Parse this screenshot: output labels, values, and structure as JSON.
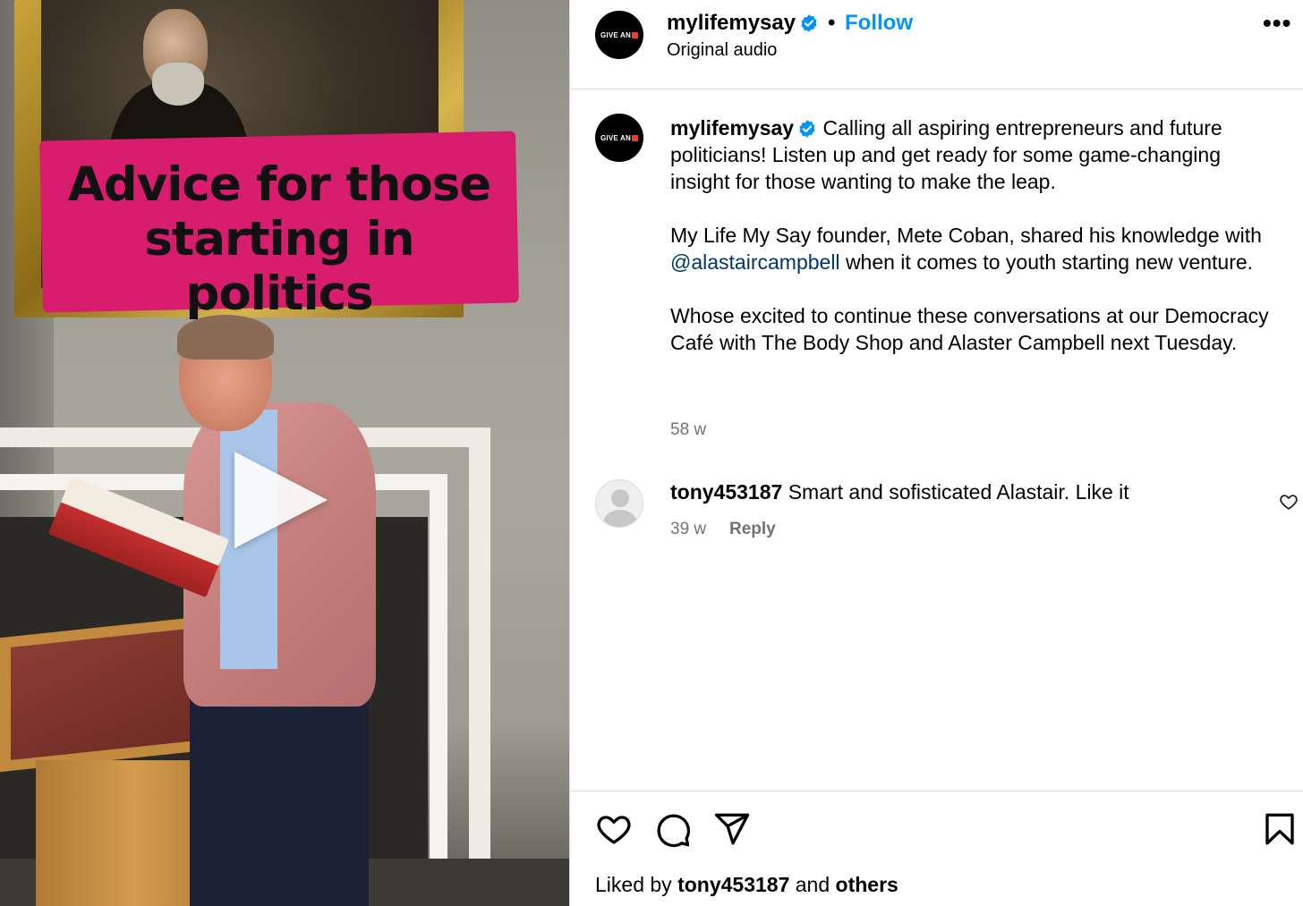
{
  "video": {
    "overlay_text_line1": "Advice for those",
    "overlay_text_line2": "starting in politics",
    "banner_color": "#d81c6e",
    "play_icon": "play-icon"
  },
  "header": {
    "avatar_text": "GIVE AN",
    "username": "mylifemysay",
    "separator": "•",
    "follow_label": "Follow",
    "audio": "Original audio",
    "more_label": "•••"
  },
  "caption": {
    "username": "mylifemysay",
    "para1": "Calling all aspiring entrepreneurs and future politicians! Listen up and get ready for some game-changing insight for those wanting to make the leap.",
    "para2_before": "My Life My Say founder, Mete Coban, shared his knowledge with",
    "mention": "@alastaircampbell",
    "para2_after": "when it comes to youth starting new venture.",
    "para3": "Whose excited to continue these conversations at our Democracy Café with The Body Shop and Alaster Campbell next Tuesday.",
    "time": "58 w"
  },
  "comment": {
    "username": "tony453187",
    "text": "Smart and sofisticated Alastair. Like it",
    "time": "39 w",
    "reply_label": "Reply"
  },
  "footer": {
    "liked_by_prefix": "Liked by",
    "liked_by_user": "tony453187",
    "liked_by_and": "and",
    "liked_by_others": "others"
  },
  "colors": {
    "accent": "#0095f6",
    "mention": "#00376b",
    "secondary_text": "#737373",
    "verified": "#0095f6"
  }
}
